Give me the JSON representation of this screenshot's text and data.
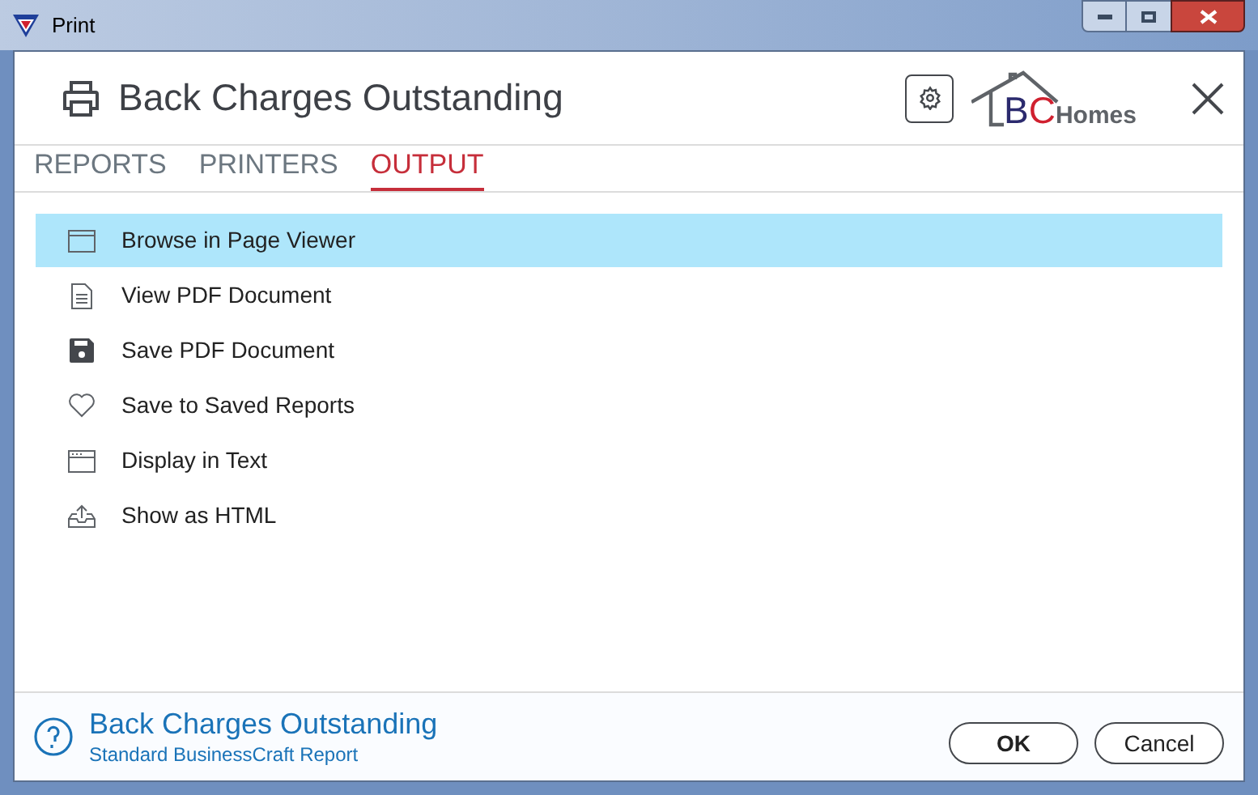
{
  "window": {
    "title": "Print"
  },
  "header": {
    "title": "Back Charges Outstanding",
    "logo": {
      "letters": [
        {
          "text": "B",
          "color": "#2b2a6e"
        },
        {
          "text": "C",
          "color": "#d0202f"
        }
      ],
      "suffix": "Homes"
    }
  },
  "tabs": [
    {
      "label": "REPORTS",
      "selected": false
    },
    {
      "label": "PRINTERS",
      "selected": false
    },
    {
      "label": "OUTPUT",
      "selected": true
    }
  ],
  "outputs": [
    {
      "label": "Browse in Page Viewer",
      "kind": "window",
      "selected": true
    },
    {
      "label": "View PDF Document",
      "kind": "document",
      "selected": false
    },
    {
      "label": "Save PDF Document",
      "kind": "floppy",
      "selected": false
    },
    {
      "label": "Save to Saved Reports",
      "kind": "heart",
      "selected": false
    },
    {
      "label": "Display in Text",
      "kind": "console",
      "selected": false
    },
    {
      "label": "Show as HTML",
      "kind": "upload",
      "selected": false
    }
  ],
  "footer": {
    "title": "Back Charges Outstanding",
    "subtitle": "Standard BusinessCraft Report",
    "buttons": [
      "OK",
      "Cancel"
    ]
  }
}
